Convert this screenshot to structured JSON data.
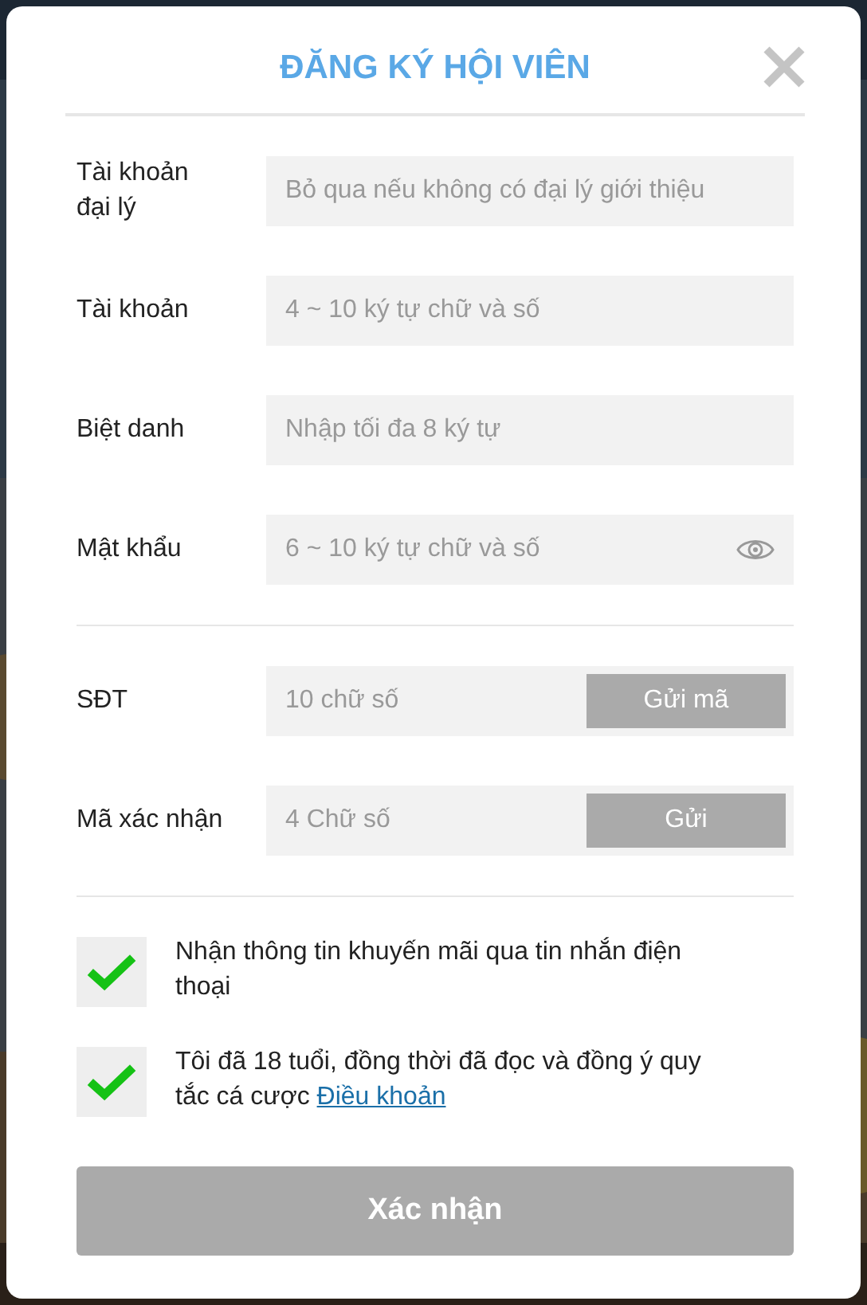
{
  "dialog": {
    "title": "ĐĂNG KÝ HỘI VIÊN"
  },
  "fields": [
    {
      "kind": "text",
      "label": "Tài khoản đại lý",
      "placeholder": "Bỏ qua nếu không có đại lý giới thiệu"
    },
    {
      "kind": "text",
      "label": "Tài khoản",
      "placeholder": "4 ~ 10 ký tự chữ và số"
    },
    {
      "kind": "text",
      "label": "Biệt danh",
      "placeholder": "Nhập tối đa 8 ký tự"
    },
    {
      "kind": "password",
      "label": "Mật khẩu",
      "placeholder": "6 ~ 10 ký tự chữ và số"
    },
    {
      "kind": "divider"
    },
    {
      "kind": "send",
      "label": "SĐT",
      "placeholder": "10 chữ số",
      "button": "Gửi mã"
    },
    {
      "kind": "send",
      "label": "Mã xác nhận",
      "placeholder": "4 Chữ số",
      "button": "Gửi"
    },
    {
      "kind": "divider"
    }
  ],
  "agreements": [
    {
      "text": "Nhận thông tin khuyến mãi qua tin nhắn điện thoại",
      "checked": true
    },
    {
      "text": "Tôi đã 18 tuổi, đồng thời đã đọc và đồng ý quy tắc cá cược",
      "link": "Điều khoản",
      "checked": true
    }
  ],
  "submit": {
    "label": "Xác nhận",
    "disabled": true
  }
}
